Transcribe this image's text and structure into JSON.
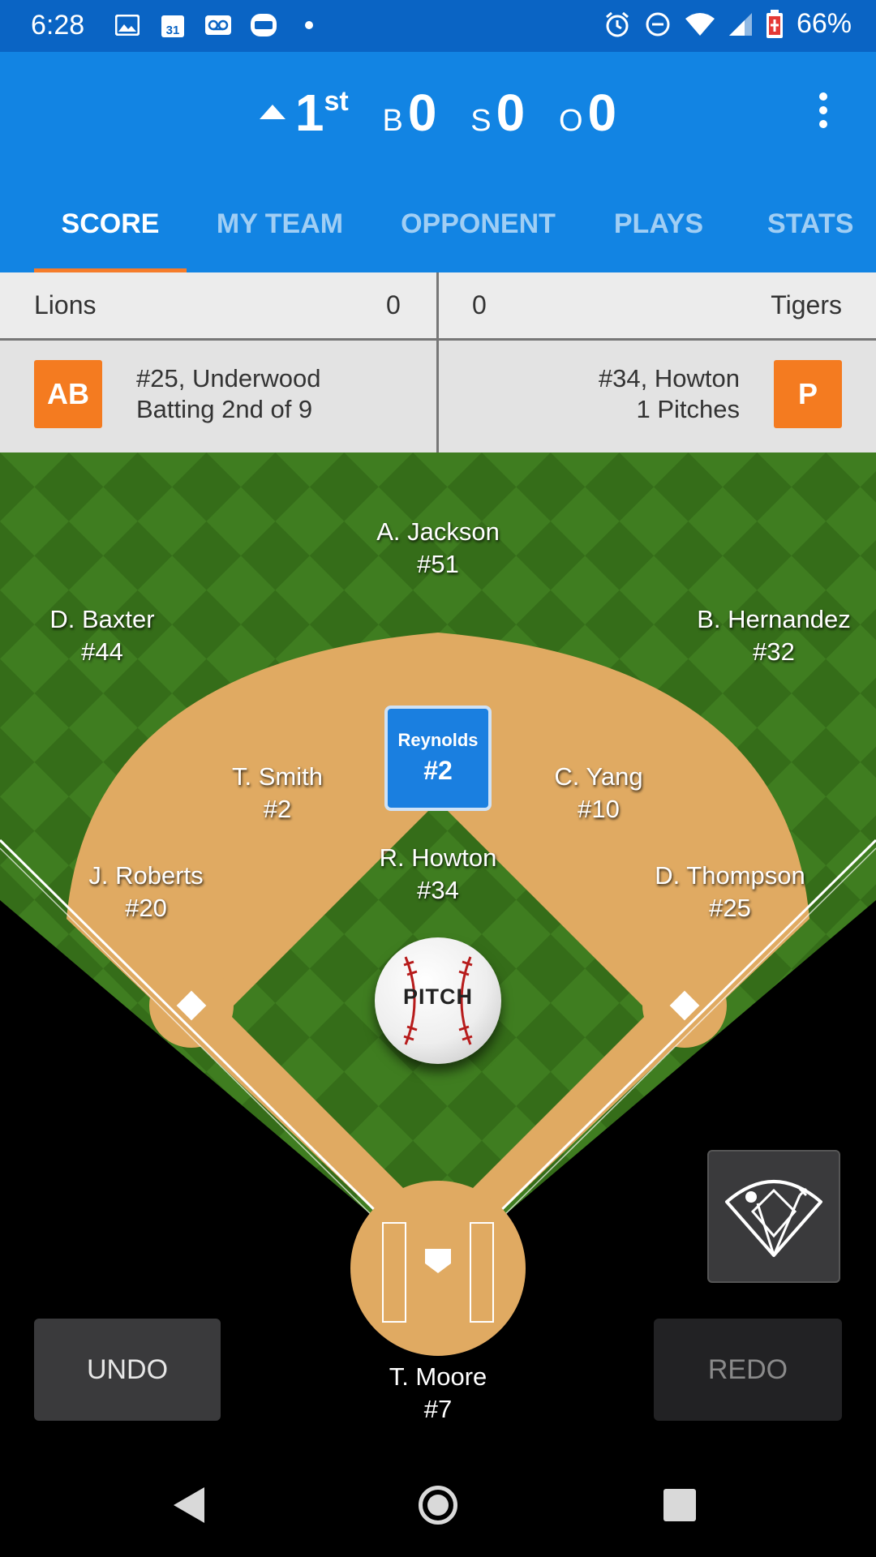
{
  "status_bar": {
    "time": "6:28",
    "battery": "66%",
    "left_icons": [
      "image-icon",
      "calendar-icon",
      "voicemail-icon",
      "app-icon",
      "dot-icon"
    ],
    "calendar_day": "31",
    "right_icons": [
      "alarm-icon",
      "dnd-icon",
      "wifi-icon",
      "signal-icon",
      "battery-icon"
    ]
  },
  "game": {
    "inning": "1",
    "inning_suffix": "st",
    "inning_half": "top",
    "balls_label": "B",
    "balls": "0",
    "strikes_label": "S",
    "strikes": "0",
    "outs_label": "O",
    "outs": "0"
  },
  "tabs": [
    {
      "label": "SCORE",
      "active": true
    },
    {
      "label": "MY TEAM"
    },
    {
      "label": "OPPONENT"
    },
    {
      "label": "PLAYS"
    },
    {
      "label": "STATS"
    }
  ],
  "teams": {
    "home": {
      "name": "Lions",
      "score": "0"
    },
    "away": {
      "name": "Tigers",
      "score": "0"
    }
  },
  "at_bat": {
    "badge": "AB",
    "line1": "#25, Underwood",
    "line2": "Batting 2nd of 9"
  },
  "pitcher": {
    "badge": "P",
    "line1": "#34, Howton",
    "line2": "1 Pitches"
  },
  "fielders": {
    "cf": {
      "name": "A. Jackson",
      "num": "#51"
    },
    "lf": {
      "name": "D. Baxter",
      "num": "#44"
    },
    "rf": {
      "name": "B. Hernandez",
      "num": "#32"
    },
    "ss": {
      "name": "T. Smith",
      "num": "#2"
    },
    "second": {
      "name": "C. Yang",
      "num": "#10"
    },
    "third": {
      "name": "J. Roberts",
      "num": "#20"
    },
    "first": {
      "name": "D. Thompson",
      "num": "#25"
    },
    "pitcher": {
      "name": "R. Howton",
      "num": "#34"
    },
    "catcher": {
      "name": "T. Moore",
      "num": "#7"
    }
  },
  "runner": {
    "name": "Reynolds",
    "num": "#2"
  },
  "pitch_button": "PITCH",
  "undo_label": "UNDO",
  "redo_label": "REDO",
  "colors": {
    "header": "#1284e3",
    "status_bar": "#0a64c4",
    "accent": "#f47b20",
    "grass": "#3d7a1e",
    "dirt": "#e0aa62"
  }
}
